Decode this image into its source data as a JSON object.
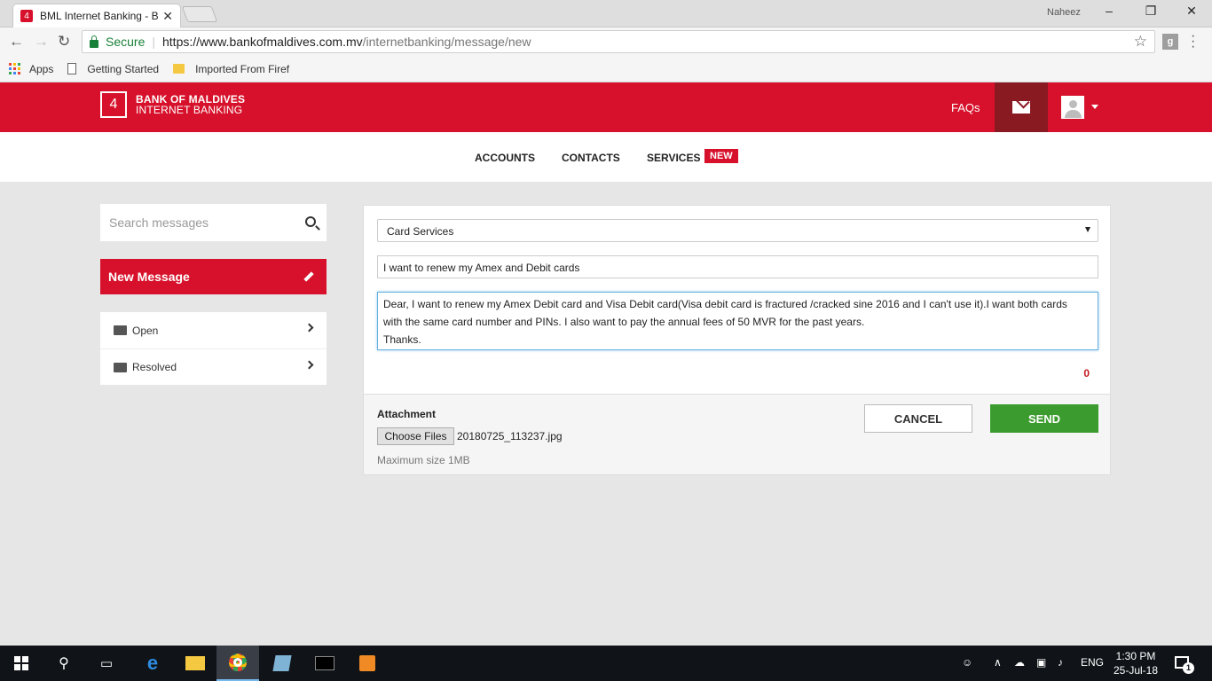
{
  "browser": {
    "tab_title": "BML Internet Banking - B",
    "tab_close": "✕",
    "user_name": "Naheez",
    "secure_label": "Secure",
    "url_host": "https://www.bankofmaldives.com.mv",
    "url_path": "/internetbanking/message/new",
    "bookmarks": [
      "Apps",
      "Getting Started",
      "Imported From Firef"
    ]
  },
  "header": {
    "logo_line1": "BANK OF MALDIVES",
    "logo_line2": "INTERNET BANKING",
    "faqs": "FAQs",
    "brand_color": "#d7112b"
  },
  "nav": {
    "accounts": "ACCOUNTS",
    "contacts": "CONTACTS",
    "services": "SERVICES",
    "new_badge": "NEW"
  },
  "sidebar": {
    "search_placeholder": "Search messages",
    "new_message": "New Message",
    "folders": [
      "Open",
      "Resolved"
    ]
  },
  "compose": {
    "category": "Card Services",
    "subject": "I want to renew my Amex and Debit cards",
    "body_line1": "Dear, I want to renew my Amex Debit card and Visa Debit card(Visa debit card is fractured /cracked sine 2016 and I can't use it).I want both cards",
    "body_line2": "with the same card number and PINs. I also want to pay the annual fees of 50 MVR for the past years.",
    "body_line3": "Thanks.",
    "counter": "0",
    "attachment_label": "Attachment",
    "choose_files": "Choose Files",
    "file_name": "20180725_113237.jpg",
    "max_size": "Maximum size 1MB",
    "cancel": "CANCEL",
    "send": "SEND"
  },
  "taskbar": {
    "language": "ENG",
    "time": "1:30 PM",
    "date": "25-Jul-18",
    "notification_count": "1"
  }
}
